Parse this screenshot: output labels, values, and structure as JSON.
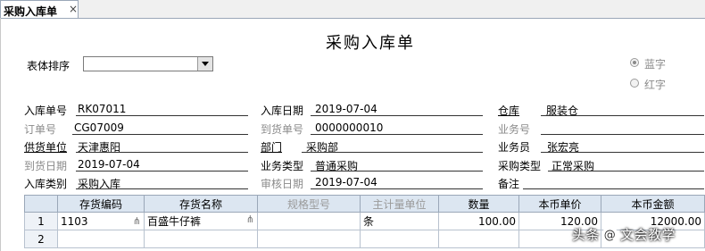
{
  "tab": {
    "label": "采购入库单",
    "close": "×"
  },
  "form": {
    "title": "采购入库单",
    "sort_label": "表体排序",
    "radio_blue": "蓝字",
    "radio_red": "红字"
  },
  "fields": {
    "receipt_no_label": "入库单号",
    "receipt_no": "RK07011",
    "receipt_date_label": "入库日期",
    "receipt_date": "2019-07-04",
    "warehouse_label": "仓库",
    "warehouse": "服装仓",
    "order_no_label": "订单号",
    "order_no": "CG07009",
    "arrival_no_label": "到货单号",
    "arrival_no": "0000000010",
    "business_no_label": "业务号",
    "business_no": "",
    "supplier_label": "供货单位",
    "supplier": "天津惠阳",
    "department_label": "部门",
    "department": "采购部",
    "salesman_label": "业务员",
    "salesman": "张宏亮",
    "arrival_date_label": "到货日期",
    "arrival_date": "2019-07-04",
    "business_type_label": "业务类型",
    "business_type": "普通采购",
    "purchase_type_label": "采购类型",
    "purchase_type": "正常采购",
    "receipt_type_label": "入库类别",
    "receipt_type": "采购入库",
    "audit_date_label": "审核日期",
    "audit_date": "2019-07-04",
    "remark_label": "备注",
    "remark": ""
  },
  "table": {
    "headers": {
      "code": "存货编码",
      "name": "存货名称",
      "spec": "规格型号",
      "unit": "主计量单位",
      "qty": "数量",
      "price": "本币单价",
      "amount": "本币金额"
    },
    "rows": [
      {
        "n": "1",
        "code": "1103",
        "name": "百盛牛仔裤",
        "spec": "",
        "unit": "条",
        "qty": "100.00",
        "price": "120.00",
        "amount": "12000.00"
      },
      {
        "n": "2",
        "code": "",
        "name": "",
        "spec": "",
        "unit": "",
        "qty": "",
        "price": "",
        "amount": ""
      }
    ]
  },
  "watermark": {
    "prefix": "头条",
    "at": "@",
    "name": "文会教学"
  }
}
